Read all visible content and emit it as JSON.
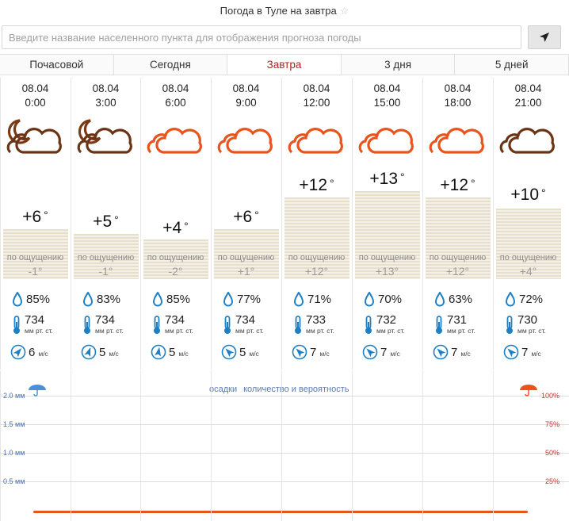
{
  "header": {
    "title": "Погода в Туле на завтра",
    "star_icon": "star-icon"
  },
  "search": {
    "placeholder": "Введите название населенного пункта для отображения прогноза погоды",
    "value": ""
  },
  "tabs": [
    {
      "label": "Почасовой",
      "active": false
    },
    {
      "label": "Сегодня",
      "active": false
    },
    {
      "label": "Завтра",
      "active": true
    },
    {
      "label": "3 дня",
      "active": false
    },
    {
      "label": "5 дней",
      "active": false
    }
  ],
  "labels": {
    "feels_like": "по ощущению",
    "pressure_unit": "мм рт. ст.",
    "wind_unit": "м/с"
  },
  "forecast": [
    {
      "date": "08.04",
      "time": "0:00",
      "icon": "moon-cloud-icon",
      "temp": "+6",
      "deg": "°",
      "feels": "-1°",
      "humidity": "85%",
      "pressure": "734",
      "wind": "6",
      "wind_dir_deg": 40
    },
    {
      "date": "08.04",
      "time": "3:00",
      "icon": "moon-cloud-icon",
      "temp": "+5",
      "deg": "°",
      "feels": "-1°",
      "humidity": "83%",
      "pressure": "734",
      "wind": "5",
      "wind_dir_deg": 20
    },
    {
      "date": "08.04",
      "time": "6:00",
      "icon": "cloud-icon",
      "temp": "+4",
      "deg": "°",
      "feels": "-2°",
      "humidity": "85%",
      "pressure": "734",
      "wind": "5",
      "wind_dir_deg": 10
    },
    {
      "date": "08.04",
      "time": "9:00",
      "icon": "cloud-icon",
      "temp": "+6",
      "deg": "°",
      "feels": "+1°",
      "humidity": "77%",
      "pressure": "734",
      "wind": "5",
      "wind_dir_deg": -45
    },
    {
      "date": "08.04",
      "time": "12:00",
      "icon": "cloud-icon",
      "temp": "+12",
      "deg": "°",
      "feels": "+12°",
      "humidity": "71%",
      "pressure": "733",
      "wind": "7",
      "wind_dir_deg": -45
    },
    {
      "date": "08.04",
      "time": "15:00",
      "icon": "cloud-icon",
      "temp": "+13",
      "deg": "°",
      "feels": "+13°",
      "humidity": "70%",
      "pressure": "732",
      "wind": "7",
      "wind_dir_deg": -45
    },
    {
      "date": "08.04",
      "time": "18:00",
      "icon": "cloud-icon",
      "temp": "+12",
      "deg": "°",
      "feels": "+12°",
      "humidity": "63%",
      "pressure": "731",
      "wind": "7",
      "wind_dir_deg": -45
    },
    {
      "date": "08.04",
      "time": "21:00",
      "icon": "dark-cloud-icon",
      "temp": "+10",
      "deg": "°",
      "feels": "+4°",
      "humidity": "72%",
      "pressure": "730",
      "wind": "7",
      "wind_dir_deg": -45
    }
  ],
  "precipitation": {
    "legend_precip": "осадки",
    "legend_detail": "количество и вероятность",
    "amount_labels": [
      "2.0 мм",
      "1.5 мм",
      "1.0 мм",
      "0.5 мм"
    ],
    "probability_labels": [
      "100%",
      "75%",
      "50%",
      "25%"
    ],
    "amount_icon": "umbrella-icon",
    "probability_icon": "umbrella-icon"
  },
  "colors": {
    "accent": "#e8541c",
    "active_tab": "#b22222",
    "moon": "#7a3a16",
    "humidity_drop": "#1f7fc4",
    "pressure": "#1f7fc4",
    "wind": "#1f7fc4",
    "dark_cloud": "#6b3416"
  }
}
